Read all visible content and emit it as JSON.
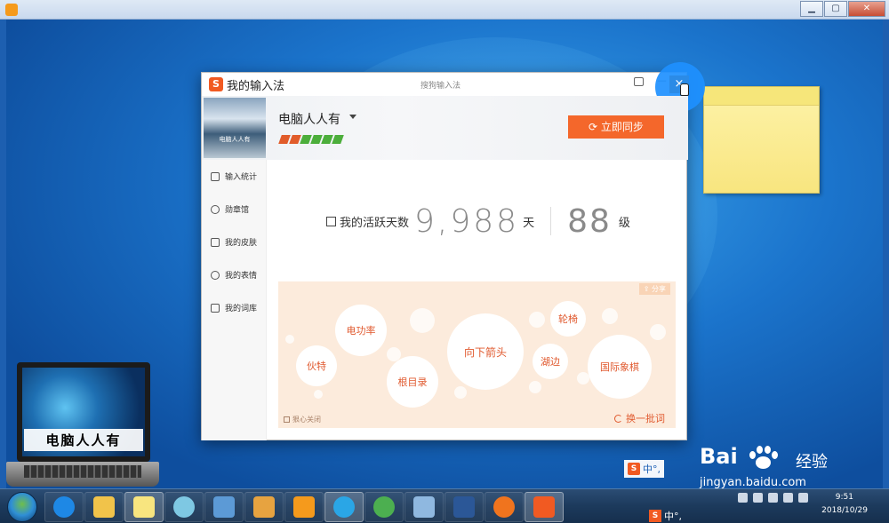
{
  "ime_window": {
    "title": "我的输入法",
    "subtitle": "搜狗输入法",
    "close_symbol": "×",
    "minimize_symbol": "—",
    "header": {
      "username": "电脑人人有",
      "avatar_caption": "电脑人人有",
      "sync_button": "立即同步",
      "badge_colors": [
        "#e15c2a",
        "#e15c2a",
        "#4cae3b",
        "#4cae3b",
        "#4cae3b",
        "#4cae3b"
      ]
    },
    "sidebar": {
      "items": [
        {
          "label": "输入统计",
          "icon": "chart-icon"
        },
        {
          "label": "勋章馆",
          "icon": "medal-icon"
        },
        {
          "label": "我的皮肤",
          "icon": "shirt-icon"
        },
        {
          "label": "我的表情",
          "icon": "smile-icon"
        },
        {
          "label": "我的词库",
          "icon": "book-icon"
        }
      ]
    },
    "stats": {
      "active_label": "我的活跃天数",
      "active_days": "9,988",
      "days_unit": "天",
      "level": "88",
      "level_unit": "级"
    },
    "word_cloud": {
      "share": "分享",
      "words": [
        "电功率",
        "伙特",
        "根目录",
        "向下箭头",
        "轮椅",
        "湖边",
        "国际象棋"
      ],
      "close_label": "狠心关闭",
      "refresh_label": "换一批词"
    }
  },
  "desktop": {
    "laptop_label": "电脑人人有"
  },
  "ime_status_bar": {
    "logo": "S",
    "mode": "中",
    "punct": "°,"
  },
  "taskbar": {
    "time": "9:51",
    "date": "2018/10/29"
  },
  "watermark": {
    "logo": "Bai",
    "logo_suffix": "百度",
    "text": "经验",
    "url": "jingyan.baidu.com"
  },
  "colors": {
    "accent": "#f4672b",
    "close_highlight": "#1e90ff",
    "word_color": "#e0592e"
  }
}
